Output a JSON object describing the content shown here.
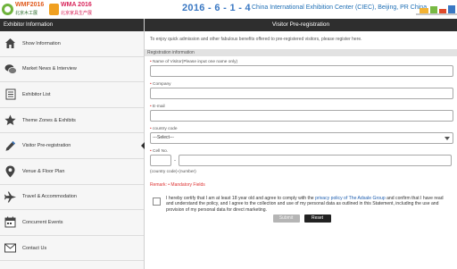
{
  "banner": {
    "logo1_title": "WMF2016",
    "logo1_sub": "北京木工展",
    "logo2_title": "WMA 2016",
    "logo2_sub": "北京家具生产展",
    "date": "2016 - 6 - 1 - 4",
    "venue": "China International Exhibition Center (CIEC), Beijing, PR China"
  },
  "sidebar": {
    "header": "Exhibitor Information",
    "items": [
      {
        "label": "Show Information",
        "icon": "house-icon"
      },
      {
        "label": "Market News & Interview",
        "icon": "chat-bubbles-icon"
      },
      {
        "label": "Exhibitor List",
        "icon": "list-icon"
      },
      {
        "label": "Theme Zones & Exhibits",
        "icon": "star-icon"
      },
      {
        "label": "Visitor Pre-registration",
        "icon": "pen-icon"
      },
      {
        "label": "Venue & Floor Plan",
        "icon": "map-pin-icon"
      },
      {
        "label": "Travel & Accommodation",
        "icon": "plane-icon"
      },
      {
        "label": "Concurrent Events",
        "icon": "calendar-icon"
      },
      {
        "label": "Contact Us",
        "icon": "envelope-icon"
      }
    ]
  },
  "main": {
    "title": "Visitor Pre-registration",
    "intro": "To enjoy quick admission and other fabulous benefits offered to pre-registered visitors, please register here.",
    "section": "Registration information",
    "fields": {
      "name": "Name of Visitor(Please input one name only)",
      "company": "Company",
      "email": "E-mail",
      "country": "country code",
      "country_value": "---Select---",
      "cell": "Cell No.",
      "cell_hint": "(country code)-(number)"
    },
    "remark": "Remark: • Mandatory Fields",
    "consent_a": "I hereby certify that I am at least 18 year old and agree to comply with the ",
    "consent_link": "privacy policy of The Adsale Group",
    "consent_b": " and confirm that I have read and understand the policy, and I agree to the collection and use of my personal data as outlined in this Statement, including the use and provision of my personal data for direct marketing.",
    "submit": "Submit",
    "reset": "Reset"
  },
  "colors": {
    "header_bg": "#2e2e2e",
    "date_blue": "#3a78c3",
    "mandatory_red": "#dd3333",
    "link_blue": "#1f5fb0"
  }
}
